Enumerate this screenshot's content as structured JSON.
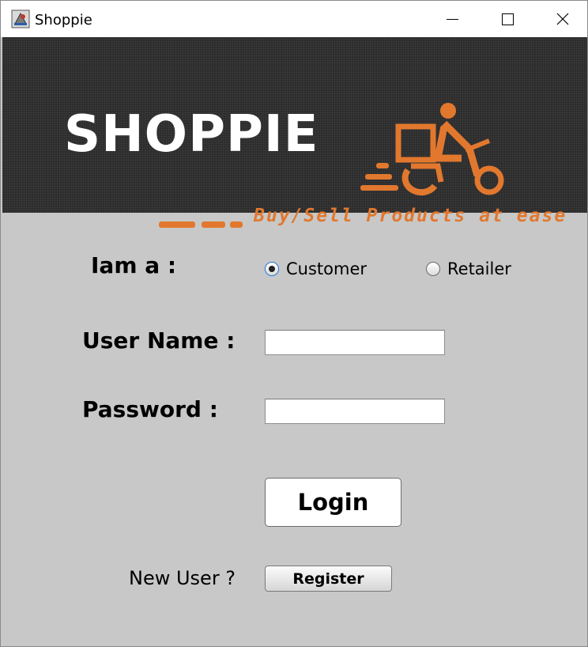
{
  "window": {
    "title": "Shoppie",
    "controls": {
      "minimize_icon": "minimize-icon",
      "maximize_icon": "maximize-icon",
      "close_icon": "close-icon"
    }
  },
  "banner": {
    "brand": "SHOPPIE",
    "tagline": "Buy/Sell Products at ease",
    "accent_color": "#e2782e",
    "background_color": "#2c2c2c"
  },
  "form": {
    "role_label": "Iam a :",
    "role_options": [
      {
        "label": "Customer",
        "selected": true
      },
      {
        "label": "Retailer",
        "selected": false
      }
    ],
    "username_label": "User Name :",
    "username_value": "",
    "password_label": "Password :",
    "password_value": "",
    "login_label": "Login",
    "new_user_text": "New User ?",
    "register_label": "Register"
  }
}
